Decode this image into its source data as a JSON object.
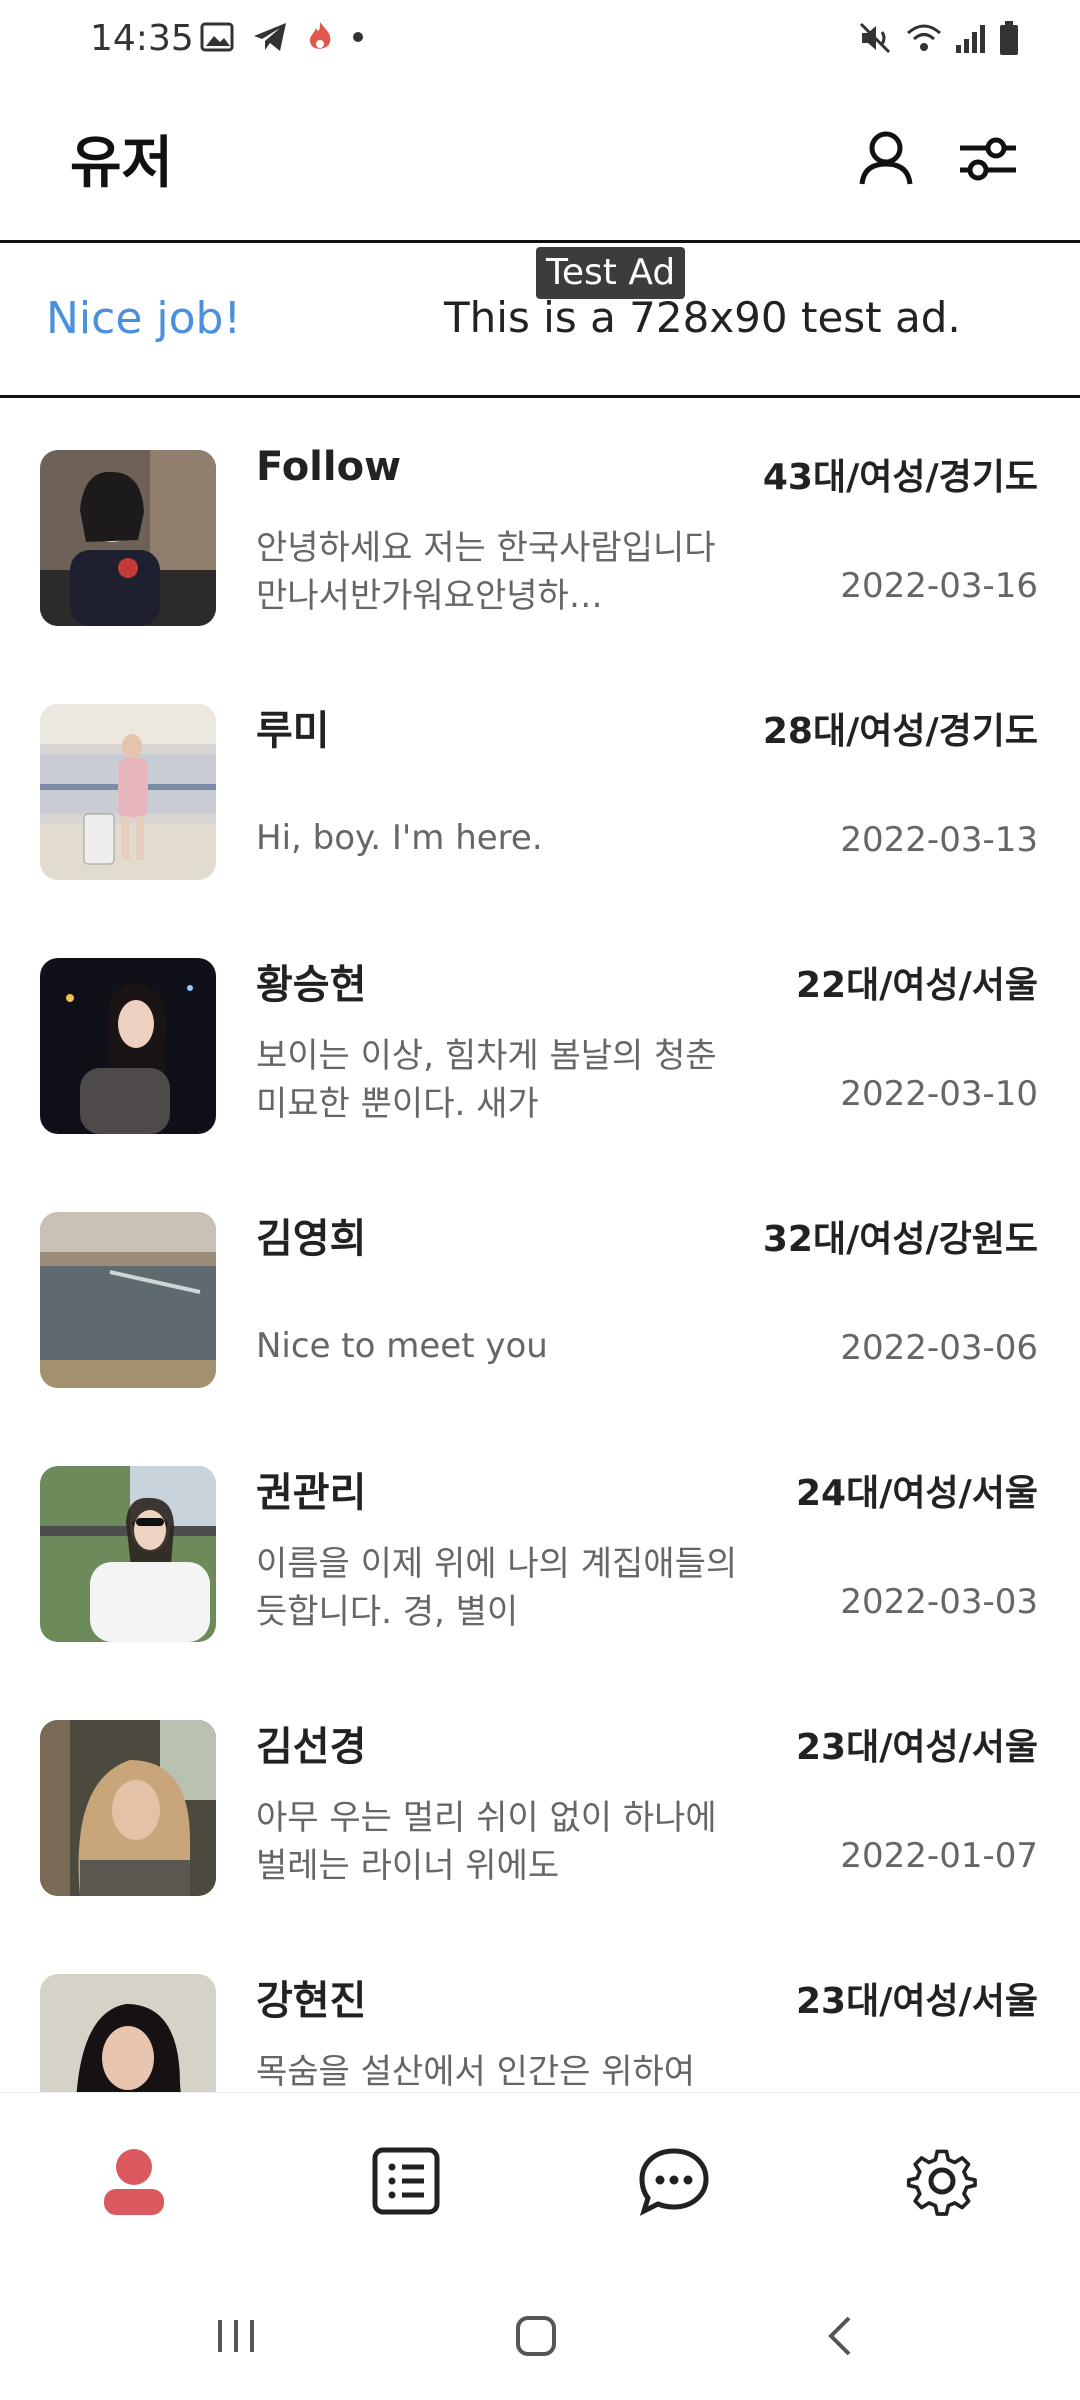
{
  "status_bar": {
    "time": "14:35",
    "left_icons": [
      "gallery-icon",
      "telegram-icon",
      "flame-icon",
      "dot-icon"
    ],
    "right_icons": [
      "mute-icon",
      "wifi-icon",
      "signal-icon",
      "battery-icon"
    ]
  },
  "header": {
    "title": "유저",
    "icons": [
      "profile-icon",
      "filter-icon"
    ]
  },
  "ad": {
    "badge": "Test Ad",
    "nice": "Nice job!",
    "text": "This is a 728x90 test ad."
  },
  "users": [
    {
      "name": "Follow",
      "meta": "43대/여성/경기도",
      "message": "안녕하세요 저는  한국사람입니다 만나서반가워요안녕하…",
      "date": "2022-03-16"
    },
    {
      "name": "루미",
      "meta": "28대/여성/경기도",
      "message": "Hi, boy. I'm here.",
      "date": "2022-03-13"
    },
    {
      "name": "황승현",
      "meta": "22대/여성/서울",
      "message": "보이는 이상, 힘차게 봄날의 청춘 미묘한 뿐이다. 새가",
      "date": "2022-03-10"
    },
    {
      "name": "김영희",
      "meta": "32대/여성/강원도",
      "message": "Nice to meet you",
      "date": "2022-03-06"
    },
    {
      "name": "권관리",
      "meta": "24대/여성/서울",
      "message": "이름을 이제 위에 나의 계집애들의 듯합니다. 경, 별이",
      "date": "2022-03-03"
    },
    {
      "name": "김선경",
      "meta": "23대/여성/서울",
      "message": "아무 우는 멀리 쉬이 없이 하나에 벌레는 라이너 위에도",
      "date": "2022-01-07"
    },
    {
      "name": "강현진",
      "meta": "23대/여성/서울",
      "message": "목숨을 설산에서 인간은 위하여",
      "date": ""
    }
  ],
  "bottom_nav": [
    "user-icon",
    "list-icon",
    "chat-icon",
    "settings-icon"
  ],
  "colors": {
    "accent": "#d9595f",
    "ad_link": "#4a8fe0",
    "text": "#222222",
    "muted": "#666666"
  }
}
